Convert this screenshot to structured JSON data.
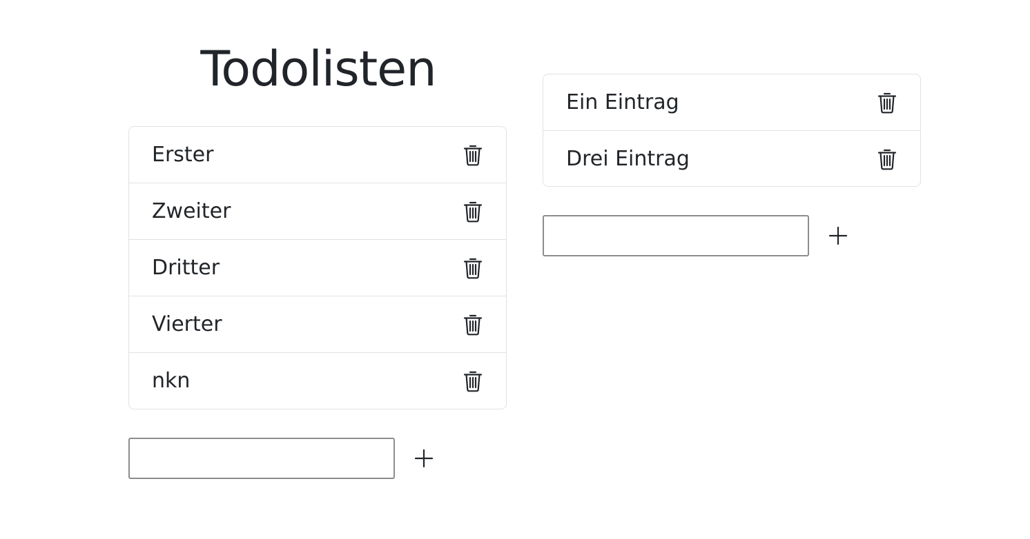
{
  "header": {
    "title": "Todolisten"
  },
  "lists": [
    {
      "items": [
        {
          "label": "Erster",
          "icon": "trash-icon"
        },
        {
          "label": "Zweiter",
          "icon": "trash-icon"
        },
        {
          "label": "Dritter",
          "icon": "trash-icon"
        },
        {
          "label": "Vierter",
          "icon": "trash-icon"
        },
        {
          "label": "nkn",
          "icon": "trash-icon"
        }
      ],
      "new_item": {
        "value": "",
        "placeholder": ""
      },
      "add_icon": "plus-icon"
    },
    {
      "items": [
        {
          "label": "Ein Eintrag",
          "icon": "trash-icon"
        },
        {
          "label": "Drei Eintrag",
          "icon": "trash-icon"
        }
      ],
      "new_item": {
        "value": "",
        "placeholder": ""
      },
      "add_icon": "plus-icon"
    }
  ],
  "colors": {
    "text": "#212529",
    "border": "#dee2e6",
    "input_border": "#8c8c8c",
    "background": "#ffffff"
  }
}
